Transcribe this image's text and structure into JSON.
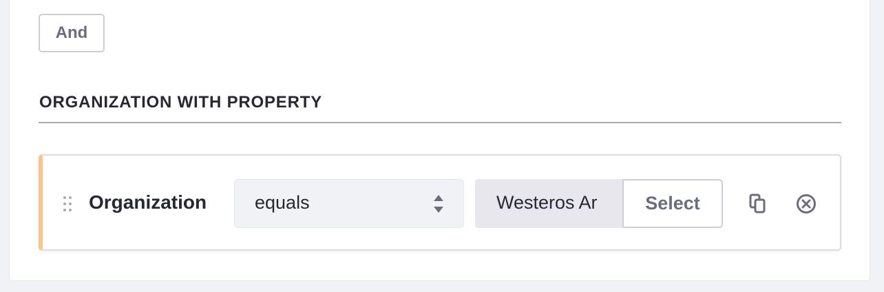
{
  "conjunction": {
    "label": "And"
  },
  "group": {
    "title": "ORGANIZATION WITH PROPERTY"
  },
  "criterion": {
    "property_label": "Organization",
    "operator": {
      "selected": "equals"
    },
    "value": "Westeros Ar",
    "select_button_label": "Select",
    "icons": {
      "drag": "drag-handle-icon",
      "operator": "select-arrows-icon",
      "duplicate": "duplicate-icon",
      "delete": "times-circle-icon"
    }
  },
  "colors": {
    "accent_border": "#f9c38b",
    "text_primary": "#272833",
    "text_secondary": "#6b6c7e",
    "page_background": "#f1f2f5"
  }
}
